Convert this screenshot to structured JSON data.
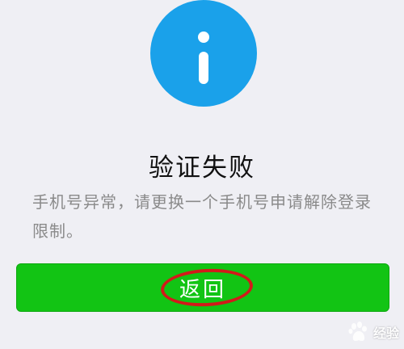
{
  "dialog": {
    "icon": "info-icon",
    "title": "验证失败",
    "message": "手机号异常，请更换一个手机号申请解除登录限制。",
    "button_label": "返回"
  },
  "watermark": {
    "text": "经验",
    "logo": "baidu-paw-logo"
  },
  "colors": {
    "background": "#efeff4",
    "icon_blue": "#1aa1ea",
    "button_green": "#12c414",
    "highlight_red": "#d21a1a",
    "message_gray": "#8a8a8a"
  }
}
